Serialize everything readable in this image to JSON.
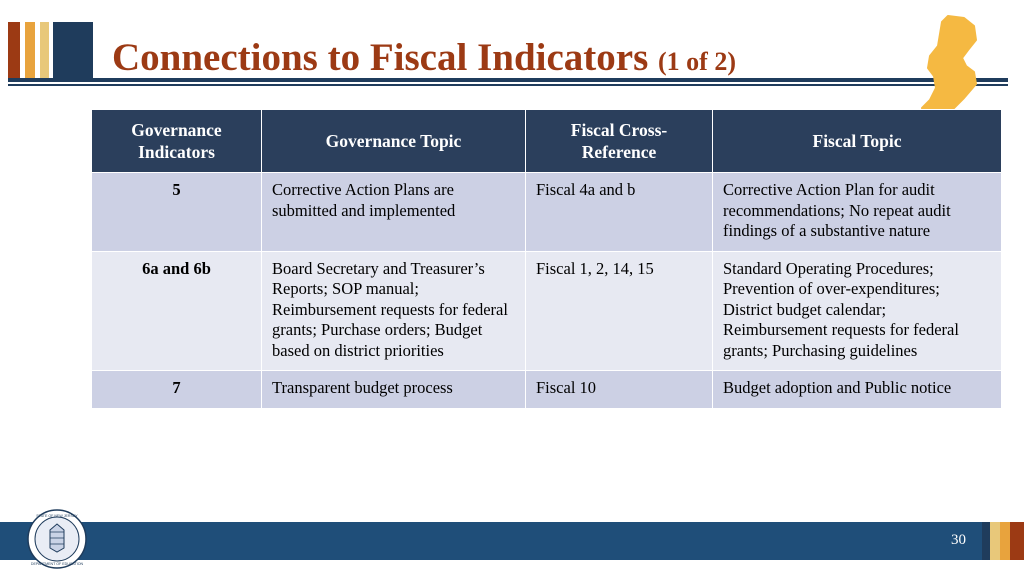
{
  "slide": {
    "title_main": "Connections to Fiscal Indicators ",
    "title_sub": "(1 of 2)",
    "page_number": "30"
  },
  "decor": {
    "bar_red": "#9c3a14",
    "bar_orange": "#e8a33d",
    "bar_gold": "#e8c87a",
    "bar_navy": "#1f3c5c",
    "title_color": "#9c3a14",
    "header_fill": "#2b3f5c",
    "row_alt_a": "#ccd0e4",
    "row_alt_b": "#e7e9f2",
    "footer_fill": "#1f4e79",
    "nj_shape_fill": "#f5b942",
    "nj_shape_name": "new-jersey-state-outline"
  },
  "table": {
    "headers": [
      "Governance Indicators",
      "Governance Topic",
      "Fiscal Cross-Reference",
      "Fiscal Topic"
    ],
    "rows": [
      {
        "indicator": "5",
        "governance_topic": "Corrective Action Plans are submitted and implemented",
        "fiscal_cross_reference": "Fiscal 4a and b",
        "fiscal_topic": "Corrective Action Plan for audit recommendations; No repeat audit findings of a substantive nature"
      },
      {
        "indicator": "6a and 6b",
        "governance_topic": "Board Secretary and Treasurer’s Reports;\nSOP manual;\nReimbursement requests for federal grants;\nPurchase orders;\nBudget based on district priorities",
        "fiscal_cross_reference": "Fiscal 1, 2, 14, 15",
        "fiscal_topic": "Standard Operating Procedures; Prevention of over-expenditures; District budget calendar; Reimbursement requests for federal grants;\nPurchasing guidelines"
      },
      {
        "indicator": "7",
        "governance_topic": "Transparent budget process",
        "fiscal_cross_reference": "Fiscal 10",
        "fiscal_topic": "Budget adoption and Public notice"
      }
    ]
  },
  "seal": {
    "label_top": "STATE OF NEW JERSEY",
    "label_bottom": "DEPARTMENT OF EDUCATION"
  }
}
